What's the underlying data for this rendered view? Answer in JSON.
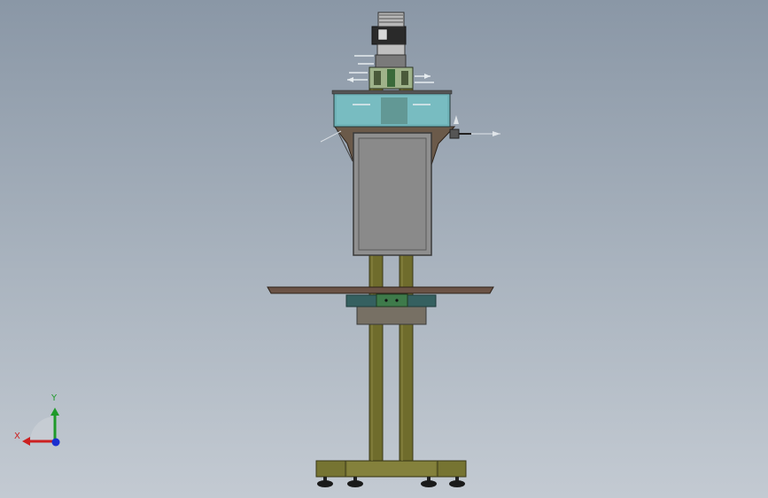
{
  "viewport": {
    "view_orientation": "front",
    "background_colors": [
      "#8a97a6",
      "#c3cad2"
    ]
  },
  "triad": {
    "x_label": "X",
    "y_label": "Y",
    "x_color": "#cc2020",
    "y_color": "#1f9a2a",
    "z_color": "#1a2fd0"
  },
  "machine": {
    "frame_color": "#6f6c2c",
    "panel_color": "#8f8f8f",
    "tray_color": "#6b5346",
    "conveyor_color": "#356060",
    "hopper_color": "#6fb3b8",
    "motor_color": "#2a2a2a"
  }
}
